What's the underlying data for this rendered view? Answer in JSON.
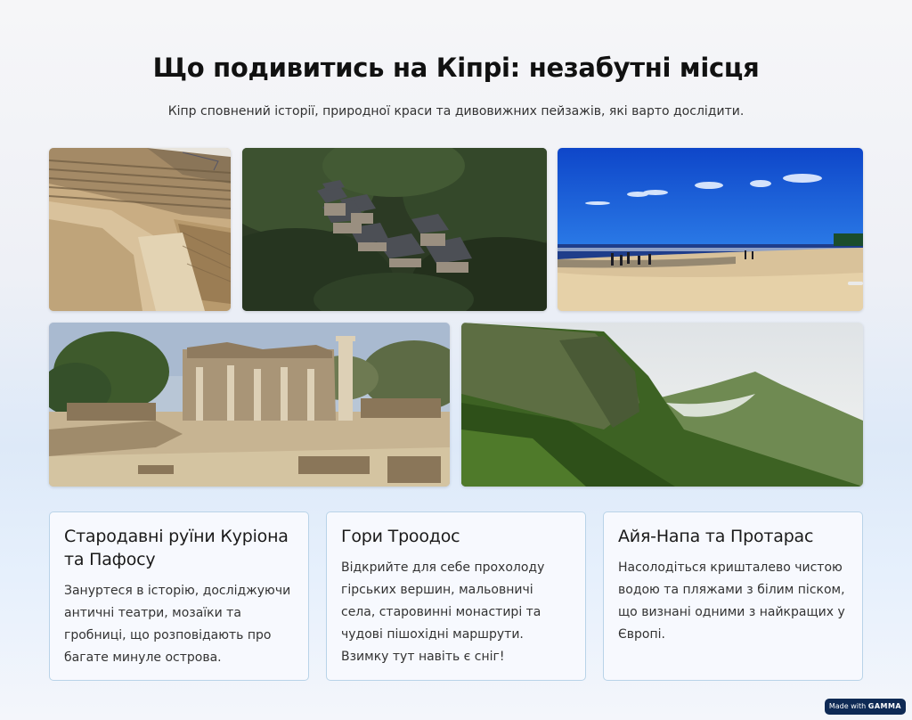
{
  "page": {
    "title": "Що подивитись на Кіпрі: незабутні місця",
    "subtitle": "Кіпр сповнений історії, природної краси та дивовижних пейзажів, які варто дослідити."
  },
  "gallery": [
    {
      "name": "photo-ancient-theatre",
      "subject": "ancient stone theatre ruins"
    },
    {
      "name": "photo-mountain-village",
      "subject": "stone houses in forest"
    },
    {
      "name": "photo-beach",
      "subject": "sandy beach with blue sky"
    },
    {
      "name": "photo-basilica-ruins",
      "subject": "ruined basilica columns"
    },
    {
      "name": "photo-green-mountains",
      "subject": "green mountain ridge with clouds"
    }
  ],
  "cards": [
    {
      "title": "Стародавні руїни Куріона та Пафосу",
      "text": "Зануртеся в історію, досліджуючи античні театри, мозаїки та гробниці, що розповідають про багате минуле острова."
    },
    {
      "title": "Гори Троодос",
      "text": "Відкрийте для себе прохолоду гірських вершин, мальовничі села, старовинні монастирі та чудові пішохідні маршрути. Взимку тут навіть є сніг!"
    },
    {
      "title": "Айя-Напа та Протарас",
      "text": "Насолодіться кришталево чистою водою та пляжами з білим піском, що визнані одними з найкращих у Європі."
    }
  ],
  "badge": {
    "prefix": "Made with",
    "brand": "GAMMA"
  }
}
